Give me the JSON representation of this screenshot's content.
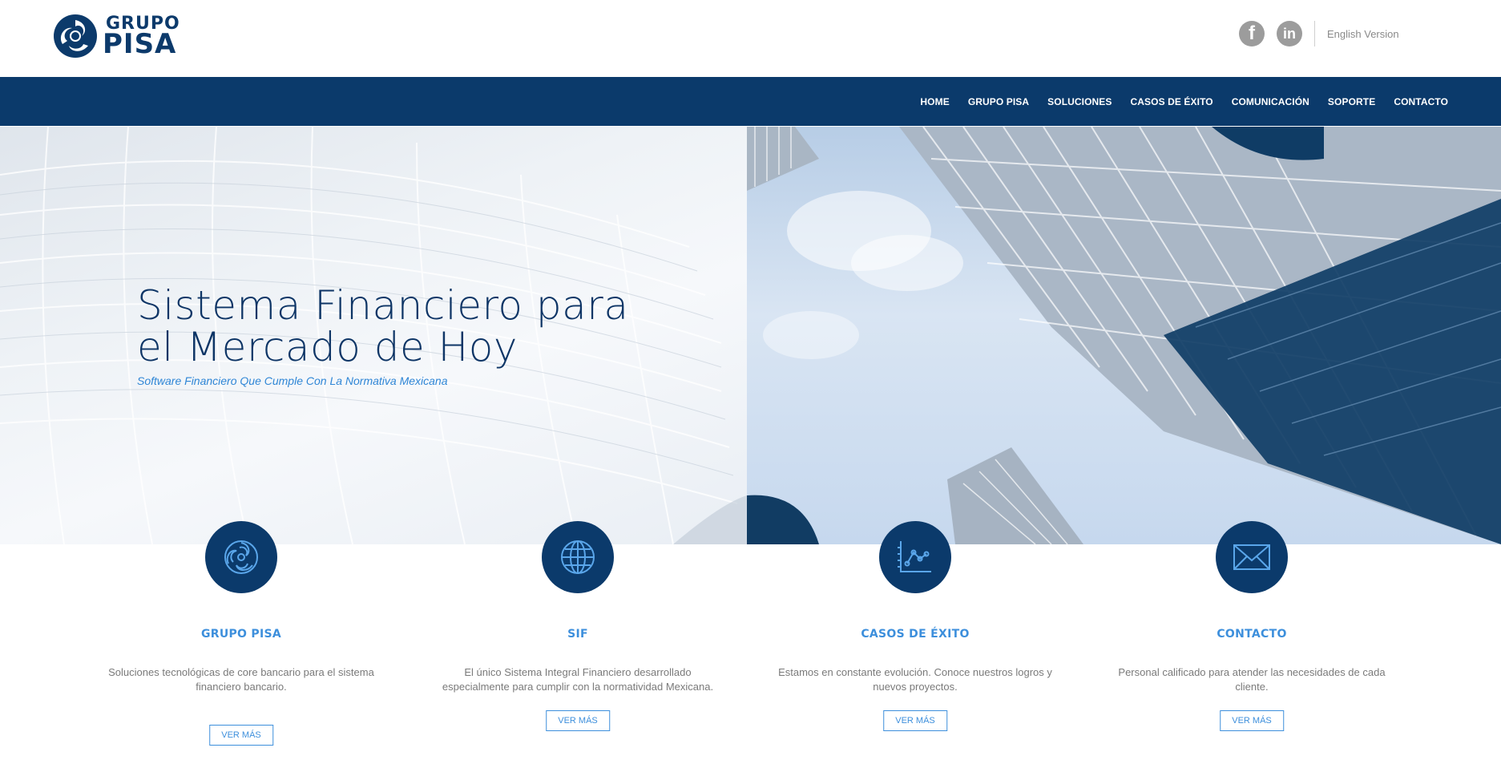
{
  "brand": {
    "line1": "GRUPO",
    "line2": "PISA",
    "color": "#0c3a6b"
  },
  "header": {
    "social": [
      {
        "name": "facebook-icon",
        "glyph": "f"
      },
      {
        "name": "linkedin-icon",
        "glyph": "in"
      }
    ],
    "language_link": "English Version"
  },
  "nav": {
    "background": "#0b3a6b",
    "items": [
      "HOME",
      "GRUPO PISA",
      "SOLUCIONES",
      "CASOS DE ÉXITO",
      "COMUNICACIÓN",
      "SOPORTE",
      "CONTACTO"
    ]
  },
  "hero": {
    "title_line1": "Sistema Financiero para",
    "title_line2": "el Mercado de Hoy",
    "subtitle": "Software Financiero Que Cumple Con La Normativa Mexicana"
  },
  "features": [
    {
      "icon": "grupo-pisa-logo-icon",
      "title": "GRUPO PISA",
      "text": "Soluciones tecnológicas de core bancario para el sistema financiero bancario.",
      "button": "VER MÁS"
    },
    {
      "icon": "globe-icon",
      "title": "SIF",
      "text": "El único Sistema Integral Financiero desarrollado especialmente para cumplir con la normatividad Mexicana.",
      "button": "VER MÁS"
    },
    {
      "icon": "chart-icon",
      "title": "CASOS DE ÉXITO",
      "text": "Estamos en constante evolución. Conoce nuestros logros y nuevos proyectos.",
      "button": "VER MÁS"
    },
    {
      "icon": "envelope-icon",
      "title": "CONTACTO",
      "text": "Personal calificado para atender las necesidades de cada cliente.",
      "button": "VER MÁS"
    }
  ],
  "colors": {
    "accent": "#3d8fdc",
    "navy": "#0b3a6b",
    "body_text": "#7a7a7a"
  }
}
